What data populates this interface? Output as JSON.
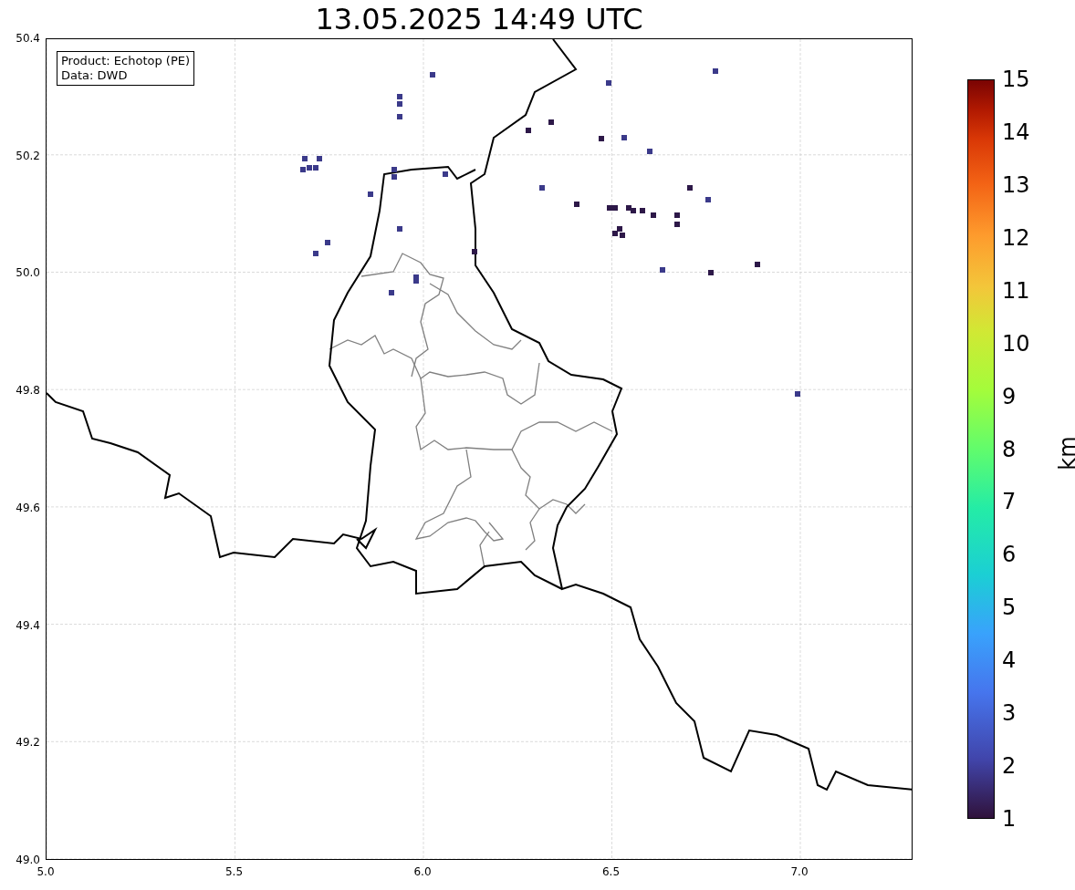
{
  "title": "13.05.2025 14:49 UTC",
  "info_box": {
    "lines": [
      "Product: Echotop (PE)",
      "Data: DWD"
    ]
  },
  "y_ticks": [
    "50.4",
    "50.2",
    "50.0",
    "49.8",
    "49.6",
    "49.4",
    "49.2",
    "49.0"
  ],
  "x_ticks": [
    "5.0",
    "5.5",
    "6.0",
    "6.5",
    "7.0"
  ],
  "colorbar": {
    "label": "km",
    "ticks": [
      "15",
      "14",
      "13",
      "12",
      "11",
      "10",
      "9",
      "8",
      "7",
      "6",
      "5",
      "4",
      "3",
      "2",
      "1"
    ]
  }
}
